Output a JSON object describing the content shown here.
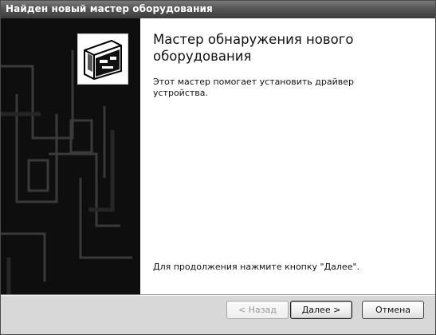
{
  "window": {
    "title": "Найден новый мастер оборудования"
  },
  "main": {
    "heading": "Мастер обнаружения нового оборудования",
    "description": "Этот мастер помогает установить драйвер устройства.",
    "continue_hint": "Для продолжения нажмите кнопку \"Далее\"."
  },
  "buttons": {
    "back": "< Назад",
    "next": "Далее >",
    "cancel": "Отмена"
  },
  "icons": {
    "wizard": "hardware-wizard-icon",
    "side": "decorative-circuit-graphic"
  },
  "colors": {
    "title_bar": "#4a4a4a",
    "side_panel": "#0e0e0e",
    "dialog_background": "#d8d8d8"
  }
}
